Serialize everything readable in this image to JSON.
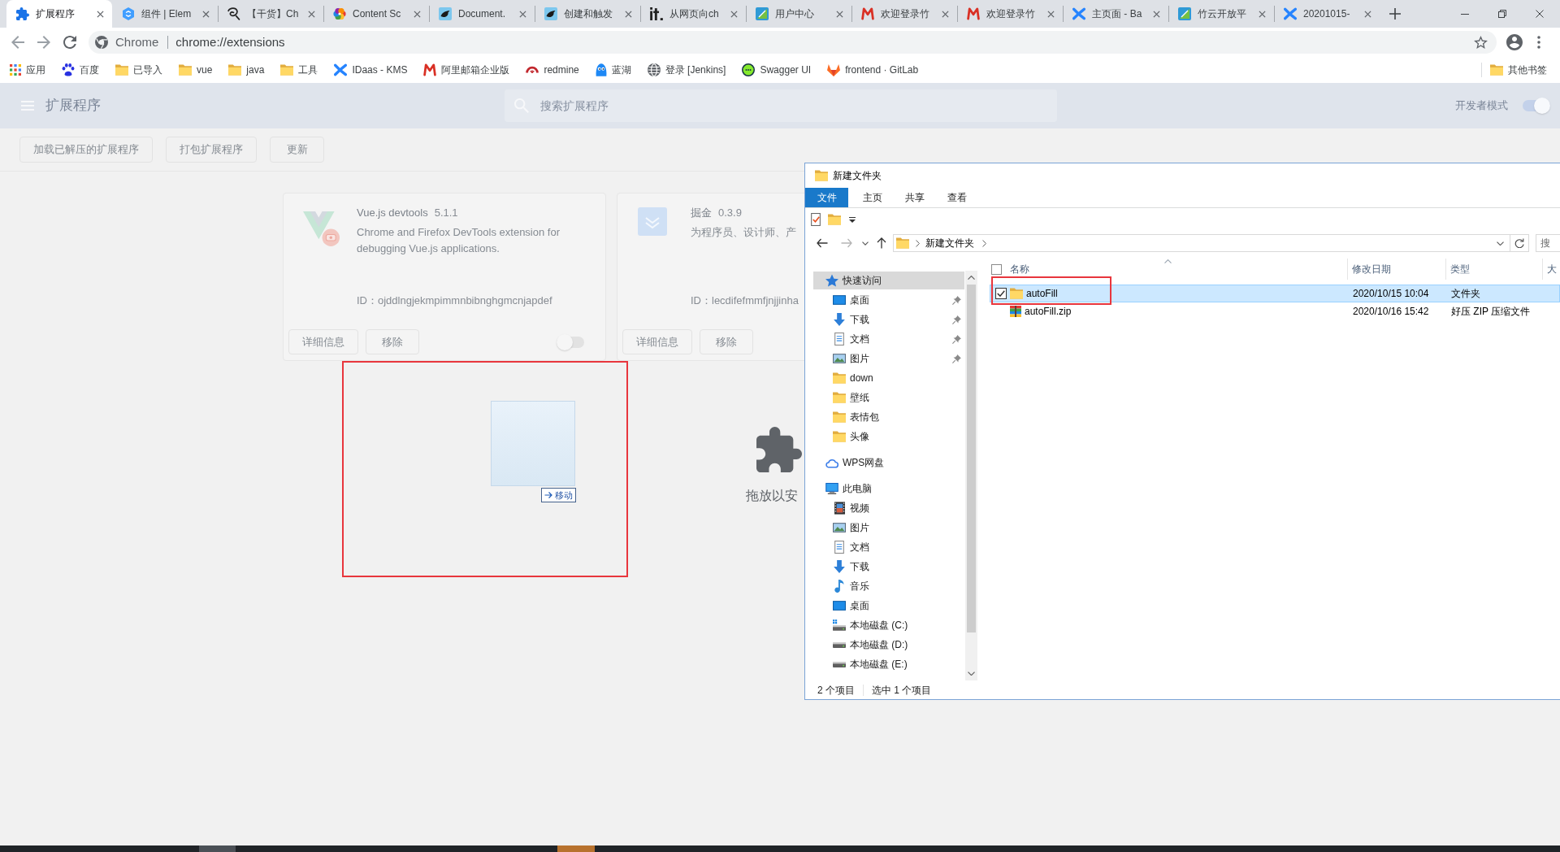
{
  "browser": {
    "tabs": [
      {
        "title": "扩展程序",
        "kind": "puzzle",
        "selected": true
      },
      {
        "title": "组件 | Elem",
        "kind": "hexagon",
        "selected": false
      },
      {
        "title": "【干货】Ch",
        "kind": "script",
        "selected": false
      },
      {
        "title": "Content Sc",
        "kind": "pinwheel",
        "selected": false
      },
      {
        "title": "Document.",
        "kind": "bird",
        "selected": false
      },
      {
        "title": "创建和触发",
        "kind": "bird",
        "selected": false
      },
      {
        "title": "从网页向ch",
        "kind": "bars",
        "selected": false
      },
      {
        "title": "用户中心",
        "kind": "leaf",
        "selected": false
      },
      {
        "title": "欢迎登录竹",
        "kind": "m",
        "selected": false
      },
      {
        "title": "欢迎登录竹",
        "kind": "m",
        "selected": false
      },
      {
        "title": "主页面 - Ba",
        "kind": "cross",
        "selected": false
      },
      {
        "title": "竹云开放平",
        "kind": "leaf",
        "selected": false
      },
      {
        "title": "20201015-",
        "kind": "cross",
        "selected": false
      }
    ],
    "address_bar": {
      "site_chip": "Chrome",
      "url": "chrome://extensions"
    },
    "bookmarks": [
      {
        "label": "应用",
        "kind": "apps"
      },
      {
        "label": "百度",
        "kind": "paw"
      },
      {
        "label": "已导入",
        "kind": "folder"
      },
      {
        "label": "vue",
        "kind": "folder"
      },
      {
        "label": "java",
        "kind": "folder"
      },
      {
        "label": "工具",
        "kind": "folder"
      },
      {
        "label": "IDaas - KMS",
        "kind": "cross"
      },
      {
        "label": "阿里邮箱企业版",
        "kind": "m"
      },
      {
        "label": "redmine",
        "kind": "arc"
      },
      {
        "label": "蓝湖",
        "kind": "mascot"
      },
      {
        "label": "登录 [Jenkins]",
        "kind": "globe"
      },
      {
        "label": "Swagger UI",
        "kind": "braces"
      },
      {
        "label": "frontend · GitLab",
        "kind": "fox"
      }
    ],
    "other_bookmarks": "其他书签"
  },
  "extensions_page": {
    "title": "扩展程序",
    "search": {
      "placeholder": "搜索扩展程序"
    },
    "developer_mode": {
      "label": "开发者模式",
      "on": true
    },
    "toolbar_buttons": [
      "加载已解压的扩展程序",
      "打包扩展程序",
      "更新"
    ],
    "cards": [
      {
        "kind": "v_logo",
        "name": "Vue.js devtools",
        "version": "5.1.1",
        "description": "Chrome and Firefox DevTools extension for debugging Vue.js applications.",
        "id": "ID：ojddlngjekmpimmnbibnghgmcnjapdef",
        "buttons": [
          "详细信息",
          "移除"
        ],
        "enabled": false
      },
      {
        "kind": "chevron_tile",
        "name": "掘金",
        "version": "0.3.9",
        "description": "为程序员、设计师、产",
        "id": "ID：lecdifefmmfjnjjinha",
        "buttons": [
          "详细信息",
          "移除"
        ]
      }
    ],
    "drop_hint": "拖放以安",
    "drag_feedback": {
      "label": "移动"
    }
  },
  "explorer": {
    "title": "新建文件夹",
    "ribbon_tabs": [
      {
        "label": "文件",
        "kind": "menu"
      },
      {
        "label": "主页",
        "kind": "tab"
      },
      {
        "label": "共享",
        "kind": "tab"
      },
      {
        "label": "查看",
        "kind": "tab"
      }
    ],
    "path": [
      "新建文件夹"
    ],
    "search": {
      "placeholder": "搜"
    },
    "nav": [
      {
        "label": "快速访问",
        "kind": "star",
        "selected": true,
        "children": [
          {
            "label": "桌面",
            "kind": "desktop",
            "pinned": true,
            "selected": false
          },
          {
            "label": "下载",
            "kind": "download",
            "pinned": true,
            "selected": false
          },
          {
            "label": "文档",
            "kind": "document",
            "pinned": true,
            "selected": false
          },
          {
            "label": "图片",
            "kind": "pictures",
            "pinned": true,
            "selected": false
          },
          {
            "label": "down",
            "kind": "folder",
            "pinned": false,
            "selected": false
          },
          {
            "label": "壁纸",
            "kind": "folder",
            "pinned": false,
            "selected": false
          },
          {
            "label": "表情包",
            "kind": "folder",
            "pinned": false,
            "selected": false
          },
          {
            "label": "头像",
            "kind": "folder",
            "pinned": false,
            "selected": false
          }
        ]
      },
      {
        "label": "WPS网盘",
        "kind": "cloud",
        "selected": false
      },
      {
        "label": "此电脑",
        "kind": "computer",
        "selected": false,
        "children": [
          {
            "label": "视频",
            "kind": "video",
            "selected": false
          },
          {
            "label": "图片",
            "kind": "pictures",
            "selected": false
          },
          {
            "label": "文档",
            "kind": "document",
            "selected": false
          },
          {
            "label": "下载",
            "kind": "download",
            "selected": false
          },
          {
            "label": "音乐",
            "kind": "music",
            "selected": false
          },
          {
            "label": "桌面",
            "kind": "desktop",
            "selected": false
          },
          {
            "label": "本地磁盘 (C:)",
            "kind": "system_drive",
            "selected": false
          },
          {
            "label": "本地磁盘 (D:)",
            "kind": "drive",
            "selected": false
          },
          {
            "label": "本地磁盘 (E:)",
            "kind": "drive",
            "selected": false
          }
        ]
      }
    ],
    "columns": [
      {
        "label": "名称",
        "sorted": true
      },
      {
        "label": "修改日期",
        "sorted": false
      },
      {
        "label": "类型",
        "sorted": false
      },
      {
        "label": "大",
        "sorted": false
      }
    ],
    "select_all_checked": false,
    "files": [
      {
        "name": "autoFill",
        "kind": "folder",
        "modified": "2020/10/15 10:04",
        "type": "文件夹",
        "selected": true,
        "checked": true
      },
      {
        "name": "autoFill.zip",
        "kind": "archive",
        "modified": "2020/10/16 15:42",
        "type": "好压 ZIP 压缩文件",
        "selected": false,
        "checked": false
      }
    ],
    "status": {
      "item_count": "2 个项目",
      "selection": "选中 1 个项目"
    }
  }
}
